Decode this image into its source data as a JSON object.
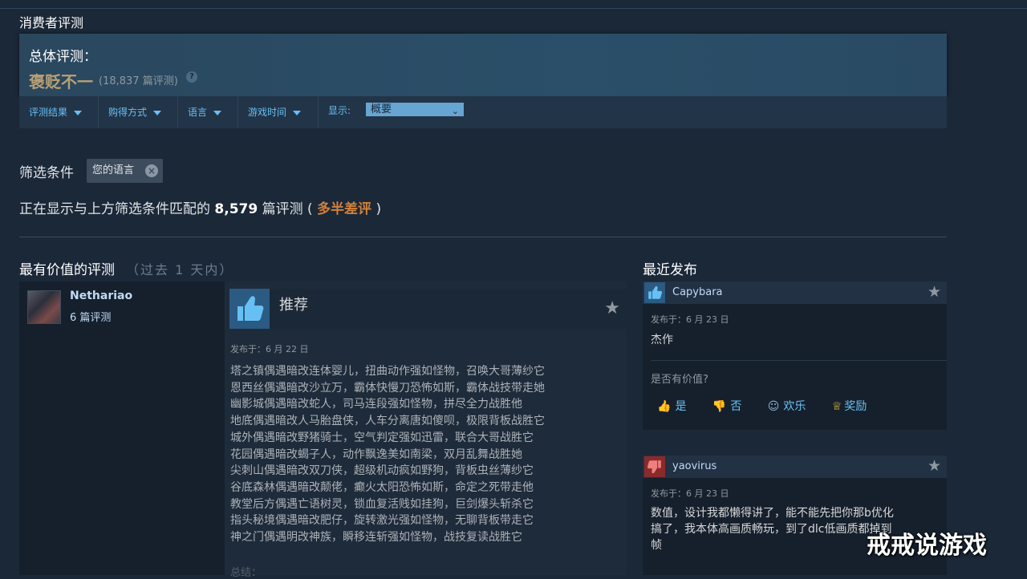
{
  "section": {
    "title": "消费者评测"
  },
  "summary": {
    "label": "总体评测：",
    "rating": "褒贬不一",
    "count": "(18,837 篇评测)",
    "help": "?"
  },
  "filters": {
    "items": [
      "评测结果",
      "购得方式",
      "语言",
      "游戏时间"
    ],
    "display_label": "显示:",
    "display_value": "概要"
  },
  "conditions": {
    "label": "筛选条件",
    "chip": "您的语言",
    "chip_remove": "×"
  },
  "showing": {
    "prefix": "正在显示与上方筛选条件匹配的",
    "count": "8,579",
    "middle": "篇评测 (",
    "rating": "多半差评",
    "suffix": ")"
  },
  "most_helpful": {
    "title": "最有价值的评测",
    "subtitle": "（过去 1 天内）"
  },
  "review": {
    "author": "Nethariao",
    "author_reviews": "6 篇评测",
    "verdict": "推荐",
    "posted": "发布于：6 月 22 日",
    "lines": [
      "塔之镇偶遇暗改连体婴儿，扭曲动作强如怪物，召唤大哥薄纱它",
      "恩西丝偶遇暗改沙立万，霸体快慢刀恐怖如斯，霸体战技带走她",
      "幽影城偶遇暗改蛇人，司马连段强如怪物，拼尽全力战胜他",
      "地底偶遇暗改人马胎盘侠，人车分离唐如傻呗，极限背板战胜它",
      "城外偶遇暗改野猪骑士，空气判定强如迅雷，联合大哥战胜它",
      "花园偶遇暗改蝎子人，动作飘逸美如南梁，双月乱舞战胜她",
      "尖刺山偶遇暗改双刀侠，超级机动疯如野狗，背板虫丝薄纱它",
      "谷底森林偶遇暗改颠佬，癫火太阳恐怖如斯，命定之死带走他",
      "教堂后方偶遇亡语树灵，锁血复活贱如挂狗，巨剑爆头斩杀它",
      "指头秘境偶遇暗改肥仔，旋转激光强如怪物，无聊背板带走它",
      "神之门偶遇明改神族，瞬移连斩强如怪物，战技复读战胜它"
    ],
    "summary_cut": "总结："
  },
  "recent": {
    "title": "最近发布",
    "reviews": [
      {
        "author": "Capybara",
        "posted": "发布于：6 月 23 日",
        "text": "杰作",
        "helpful_q": "是否有价值?",
        "votes": {
          "yes": "是",
          "no": "否",
          "funny": "欢乐",
          "award": "奖励"
        }
      },
      {
        "author": "yaovirus",
        "posted": "发布于：6 月 23 日",
        "lines": [
          "数值，设计我都懒得讲了，能不能先把你那b优化",
          "搞了，我本体高画质畅玩，到了dlc低画质都掉到",
          "帧"
        ]
      }
    ]
  },
  "watermark": "戒戒说游戏"
}
